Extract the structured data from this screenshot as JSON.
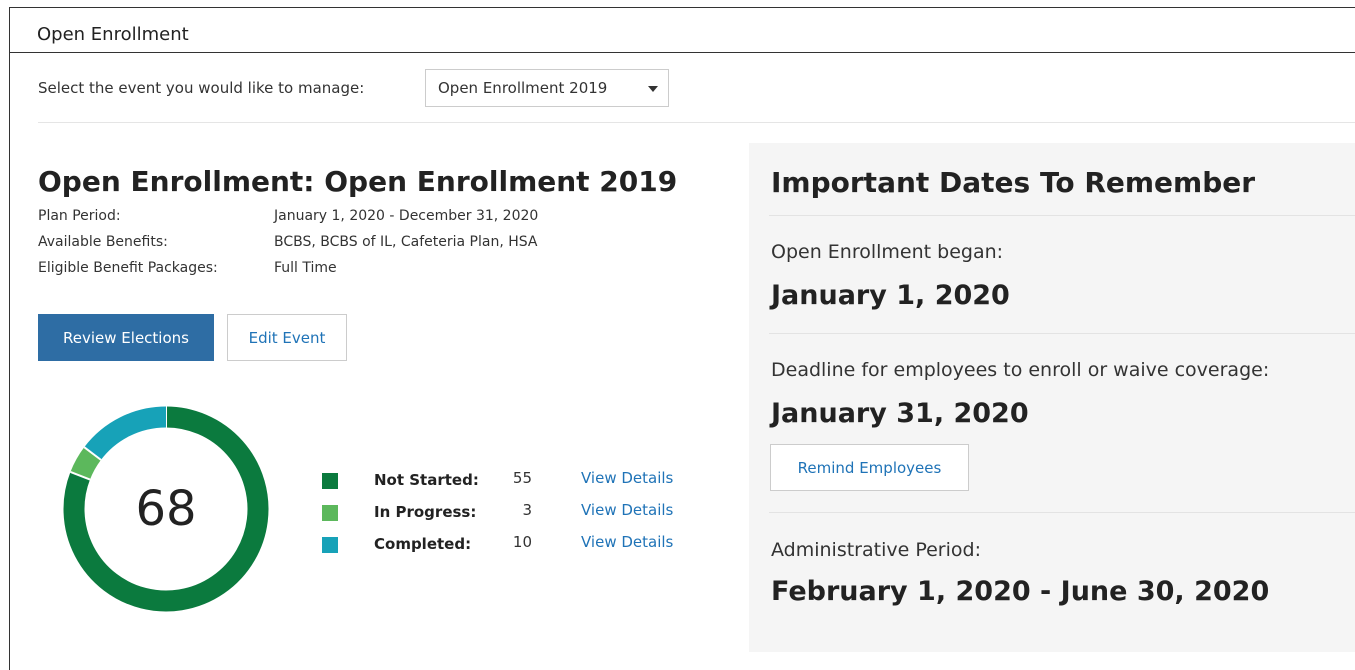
{
  "header": {
    "title": "Open Enrollment"
  },
  "selector": {
    "label": "Select the event you would like to manage:",
    "selected": "Open Enrollment 2019"
  },
  "event": {
    "title": "Open Enrollment: Open Enrollment 2019",
    "details": [
      {
        "key": "Plan Period:",
        "value": "January 1, 2020 - December 31, 2020"
      },
      {
        "key": "Available Benefits:",
        "value": "BCBS, BCBS of IL, Cafeteria Plan, HSA"
      },
      {
        "key": "Eligible Benefit Packages:",
        "value": "Full Time"
      }
    ],
    "review_label": "Review Elections",
    "edit_label": "Edit Event"
  },
  "summary": {
    "total": "68",
    "items": [
      {
        "name": "Not Started:",
        "count": "55",
        "count_value": 55,
        "link": "View Details",
        "color": "#0b7a3e"
      },
      {
        "name": "In Progress:",
        "count": "3",
        "count_value": 3,
        "link": "View Details",
        "color": "#5cb85c"
      },
      {
        "name": "Completed:",
        "count": "10",
        "count_value": 10,
        "link": "View Details",
        "color": "#17a2b8"
      }
    ]
  },
  "dates": {
    "title": "Important Dates To Remember",
    "began_label": "Open Enrollment began:",
    "began_date": "January 1, 2020",
    "deadline_label": "Deadline for employees to enroll or waive coverage:",
    "deadline_date": "January 31, 2020",
    "remind_label": "Remind Employees",
    "admin_label": "Administrative Period:",
    "admin_date": "February 1, 2020 - June 30, 2020"
  }
}
